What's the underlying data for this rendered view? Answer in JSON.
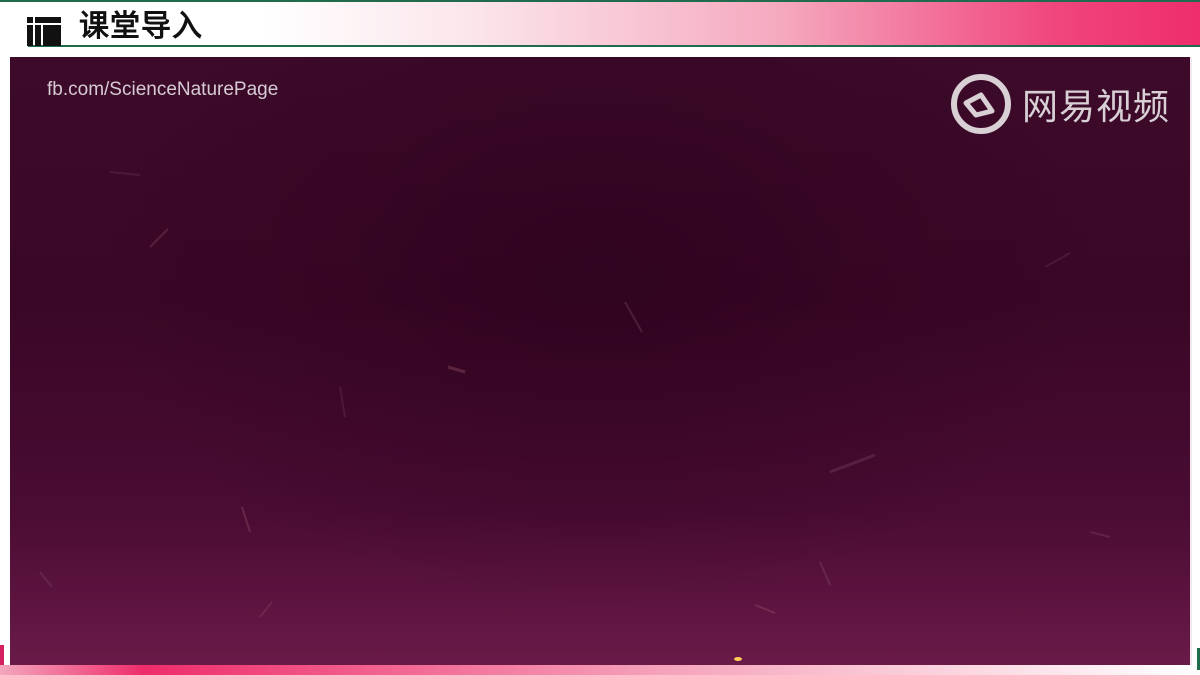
{
  "header": {
    "title": "课堂导入"
  },
  "video": {
    "source_watermark": "fb.com/ScienceNaturePage",
    "platform_watermark": "网易视频",
    "platform_icon": "netease-video-logo-icon"
  },
  "colors": {
    "accent_pink": "#ee2d6c",
    "line_green": "#1f6b4c",
    "video_bg": "#3d0a2a"
  }
}
